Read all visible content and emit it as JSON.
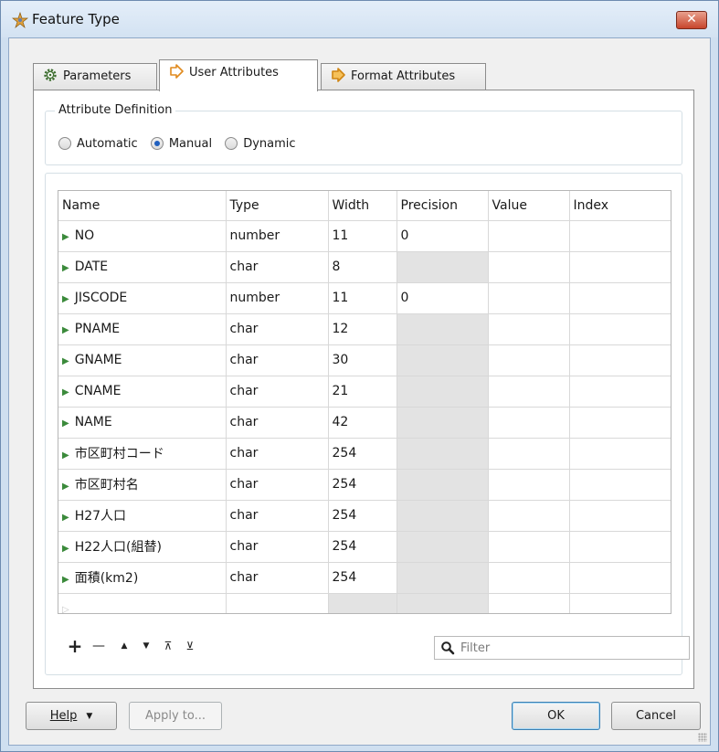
{
  "window": {
    "title": "Feature Type",
    "close_label": "✕"
  },
  "tabs": [
    {
      "label": "Parameters",
      "icon": "gear-icon"
    },
    {
      "label": "User Attributes",
      "icon": "diamond-arrow-icon",
      "active": true
    },
    {
      "label": "Format Attributes",
      "icon": "diamond-arrow-icon"
    }
  ],
  "attribute_definition": {
    "title": "Attribute Definition",
    "options": [
      "Automatic",
      "Manual",
      "Dynamic"
    ],
    "selected": "Manual"
  },
  "grid": {
    "columns": [
      "Name",
      "Type",
      "Width",
      "Precision",
      "Value",
      "Index"
    ],
    "rows": [
      {
        "name": "NO",
        "type": "number",
        "width": "11",
        "precision": "0",
        "value": "",
        "index": ""
      },
      {
        "name": "DATE",
        "type": "char",
        "width": "8",
        "precision": "",
        "value": "",
        "index": ""
      },
      {
        "name": "JISCODE",
        "type": "number",
        "width": "11",
        "precision": "0",
        "value": "",
        "index": ""
      },
      {
        "name": "PNAME",
        "type": "char",
        "width": "12",
        "precision": "",
        "value": "",
        "index": ""
      },
      {
        "name": "GNAME",
        "type": "char",
        "width": "30",
        "precision": "",
        "value": "",
        "index": ""
      },
      {
        "name": "CNAME",
        "type": "char",
        "width": "21",
        "precision": "",
        "value": "",
        "index": ""
      },
      {
        "name": "NAME",
        "type": "char",
        "width": "42",
        "precision": "",
        "value": "",
        "index": ""
      },
      {
        "name": "市区町村コード",
        "type": "char",
        "width": "254",
        "precision": "",
        "value": "",
        "index": ""
      },
      {
        "name": "市区町村名",
        "type": "char",
        "width": "254",
        "precision": "",
        "value": "",
        "index": ""
      },
      {
        "name": "H27人口",
        "type": "char",
        "width": "254",
        "precision": "",
        "value": "",
        "index": ""
      },
      {
        "name": "H22人口(組替)",
        "type": "char",
        "width": "254",
        "precision": "",
        "value": "",
        "index": ""
      },
      {
        "name": "面積(km2)",
        "type": "char",
        "width": "254",
        "precision": "",
        "value": "",
        "index": ""
      }
    ]
  },
  "toolbar": {
    "add": "+",
    "remove": "—",
    "move_up": "▲",
    "move_down": "▼",
    "move_top": "⊼",
    "move_bottom": "⊻"
  },
  "filter": {
    "placeholder": "Filter",
    "value": ""
  },
  "buttons": {
    "help": "Help",
    "apply_to": "Apply to...",
    "ok": "OK",
    "cancel": "Cancel"
  }
}
